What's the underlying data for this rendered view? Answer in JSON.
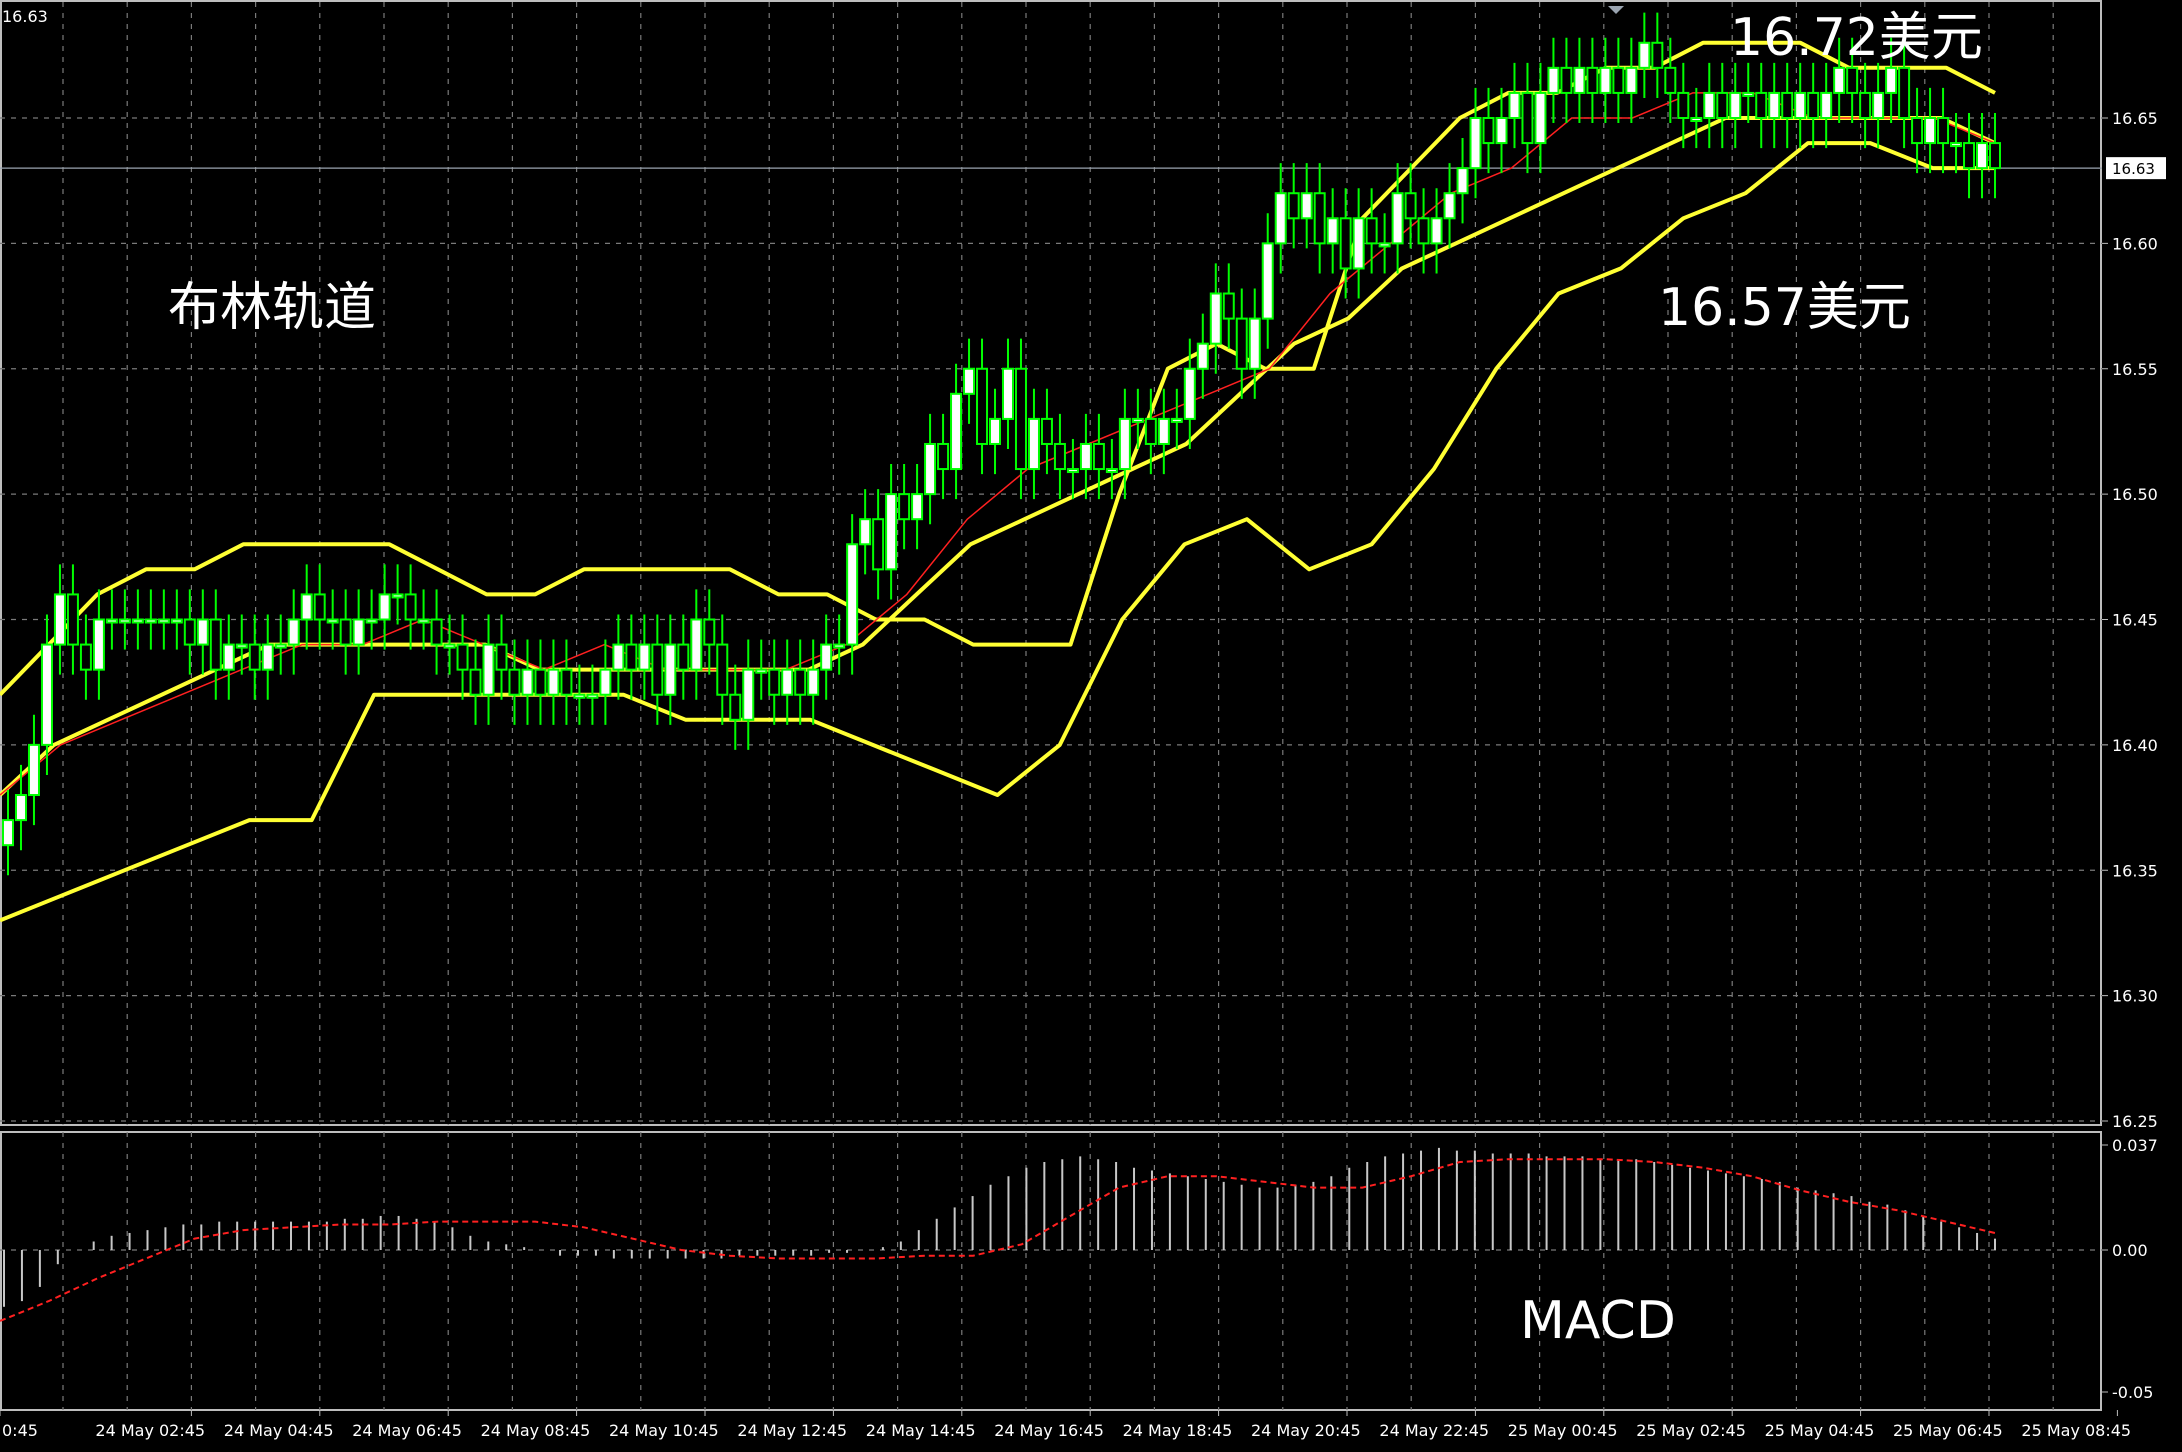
{
  "window": {
    "top_left_price": "16.63"
  },
  "colors": {
    "background": "#000000",
    "grid": "#7a7a7a",
    "bull_candle": "#00ff00",
    "bull_body": "#ffffff",
    "bear_candle": "#00ff00",
    "bear_body": "#000000",
    "bollinger": "#ffff33",
    "moving_average": "#ff2020",
    "macd_histogram": "#c8c8c8",
    "macd_signal": "#ff2020",
    "text": "#ffffff"
  },
  "annotations": {
    "bollinger_label": "布林轨道",
    "upper_price": "16.72美元",
    "lower_price": "16.57美元",
    "macd_label": "MACD"
  },
  "chart_data": [
    {
      "type": "candlestick",
      "title": "",
      "indicators": [
        "Bollinger Bands",
        "Moving Average"
      ],
      "ylim": [
        16.2,
        16.7
      ],
      "y_ticks": [
        "16.65",
        "16.60",
        "16.55",
        "16.50",
        "16.45",
        "16.40",
        "16.35",
        "16.30",
        "16.25"
      ],
      "current_price": "16.63",
      "x_ticks": [
        "0:45",
        "24 May 02:45",
        "24 May 04:45",
        "24 May 06:45",
        "24 May 08:45",
        "24 May 10:45",
        "24 May 12:45",
        "24 May 14:45",
        "24 May 16:45",
        "24 May 18:45",
        "24 May 20:45",
        "24 May 22:45",
        "25 May 00:45",
        "25 May 02:45",
        "25 May 04:45",
        "25 May 06:45",
        "25 May 08:45"
      ],
      "close": [
        16.37,
        16.38,
        16.4,
        16.44,
        16.46,
        16.44,
        16.43,
        16.45,
        16.45,
        16.45,
        16.45,
        16.45,
        16.45,
        16.45,
        16.44,
        16.45,
        16.43,
        16.44,
        16.44,
        16.43,
        16.44,
        16.44,
        16.45,
        16.46,
        16.45,
        16.45,
        16.44,
        16.45,
        16.45,
        16.46,
        16.46,
        16.45,
        16.45,
        16.44,
        16.44,
        16.43,
        16.42,
        16.44,
        16.43,
        16.42,
        16.43,
        16.42,
        16.43,
        16.42,
        16.42,
        16.42,
        16.43,
        16.44,
        16.43,
        16.44,
        16.42,
        16.44,
        16.43,
        16.45,
        16.44,
        16.42,
        16.41,
        16.43,
        16.43,
        16.42,
        16.43,
        16.42,
        16.43,
        16.44,
        16.44,
        16.48,
        16.49,
        16.47,
        16.5,
        16.49,
        16.5,
        16.52,
        16.51,
        16.54,
        16.55,
        16.52,
        16.53,
        16.55,
        16.51,
        16.53,
        16.52,
        16.51,
        16.51,
        16.52,
        16.51,
        16.51,
        16.53,
        16.53,
        16.52,
        16.53,
        16.53,
        16.55,
        16.56,
        16.58,
        16.57,
        16.55,
        16.57,
        16.6,
        16.62,
        16.61,
        16.62,
        16.6,
        16.61,
        16.59,
        16.61,
        16.6,
        16.6,
        16.62,
        16.61,
        16.6,
        16.61,
        16.62,
        16.63,
        16.65,
        16.64,
        16.65,
        16.66,
        16.64,
        16.66,
        16.67,
        16.66,
        16.67,
        16.66,
        16.67,
        16.66,
        16.67,
        16.68,
        16.67,
        16.66,
        16.65,
        16.65,
        16.66,
        16.65,
        16.66,
        16.66,
        16.65,
        16.66,
        16.65,
        16.66,
        16.65,
        16.66,
        16.67,
        16.66,
        16.65,
        16.66,
        16.67,
        16.65,
        16.64,
        16.65,
        16.64,
        16.64,
        16.63,
        16.64,
        16.63
      ],
      "bollinger_upper": [
        16.42,
        16.44,
        16.46,
        16.47,
        16.47,
        16.48,
        16.48,
        16.48,
        16.48,
        16.47,
        16.46,
        16.46,
        16.47,
        16.47,
        16.47,
        16.47,
        16.46,
        16.46,
        16.45,
        16.45,
        16.44,
        16.44,
        16.44,
        16.5,
        16.55,
        16.56,
        16.55,
        16.55,
        16.61,
        16.63,
        16.65,
        16.66,
        16.66,
        16.67,
        16.67,
        16.68,
        16.68,
        16.68,
        16.67,
        16.67,
        16.67,
        16.66
      ],
      "bollinger_middle": [
        16.38,
        16.4,
        16.41,
        16.42,
        16.43,
        16.44,
        16.44,
        16.44,
        16.44,
        16.44,
        16.43,
        16.43,
        16.43,
        16.43,
        16.43,
        16.43,
        16.44,
        16.46,
        16.48,
        16.49,
        16.5,
        16.51,
        16.52,
        16.54,
        16.56,
        16.57,
        16.59,
        16.6,
        16.61,
        16.62,
        16.63,
        16.64,
        16.65,
        16.65,
        16.65,
        16.65,
        16.65,
        16.64
      ],
      "bollinger_lower": [
        16.33,
        16.34,
        16.35,
        16.36,
        16.37,
        16.37,
        16.42,
        16.42,
        16.42,
        16.42,
        16.42,
        16.41,
        16.41,
        16.41,
        16.4,
        16.39,
        16.38,
        16.4,
        16.45,
        16.48,
        16.49,
        16.47,
        16.48,
        16.51,
        16.55,
        16.58,
        16.59,
        16.61,
        16.62,
        16.64,
        16.64,
        16.63,
        16.63
      ],
      "moving_average": [
        16.38,
        16.4,
        16.41,
        16.42,
        16.43,
        16.44,
        16.44,
        16.45,
        16.44,
        16.43,
        16.44,
        16.43,
        16.43,
        16.43,
        16.44,
        16.46,
        16.49,
        16.51,
        16.52,
        16.53,
        16.54,
        16.55,
        16.58,
        16.6,
        16.62,
        16.63,
        16.65,
        16.65,
        16.66,
        16.66,
        16.65,
        16.65,
        16.65,
        16.64
      ]
    },
    {
      "type": "bar",
      "title": "MACD",
      "ylim": [
        -0.05,
        0.037
      ],
      "y_ticks": [
        "0.037",
        "0.00",
        "-0.05"
      ],
      "histogram": [
        -0.02,
        -0.018,
        -0.013,
        -0.005,
        0.0,
        0.003,
        0.005,
        0.006,
        0.007,
        0.008,
        0.009,
        0.009,
        0.01,
        0.01,
        0.01,
        0.01,
        0.01,
        0.01,
        0.01,
        0.011,
        0.011,
        0.012,
        0.012,
        0.011,
        0.01,
        0.008,
        0.005,
        0.003,
        0.002,
        0.001,
        0.0,
        -0.002,
        -0.002,
        -0.002,
        -0.003,
        -0.003,
        -0.003,
        -0.003,
        -0.003,
        -0.003,
        -0.003,
        -0.002,
        -0.002,
        -0.002,
        -0.002,
        -0.002,
        -0.001,
        -0.001,
        0.0,
        0.001,
        0.003,
        0.007,
        0.011,
        0.015,
        0.019,
        0.023,
        0.026,
        0.029,
        0.031,
        0.032,
        0.033,
        0.032,
        0.031,
        0.029,
        0.028,
        0.027,
        0.026,
        0.025,
        0.024,
        0.023,
        0.022,
        0.022,
        0.023,
        0.024,
        0.026,
        0.029,
        0.031,
        0.033,
        0.034,
        0.035,
        0.036,
        0.035,
        0.035,
        0.034,
        0.034,
        0.034,
        0.033,
        0.033,
        0.033,
        0.032,
        0.032,
        0.032,
        0.031,
        0.03,
        0.029,
        0.028,
        0.027,
        0.026,
        0.025,
        0.024,
        0.022,
        0.021,
        0.02,
        0.019,
        0.017,
        0.016,
        0.014,
        0.012,
        0.01,
        0.008,
        0.006,
        0.004
      ],
      "signal": [
        -0.025,
        -0.018,
        -0.01,
        -0.003,
        0.004,
        0.007,
        0.008,
        0.009,
        0.009,
        0.01,
        0.01,
        0.01,
        0.008,
        0.004,
        0.0,
        -0.002,
        -0.003,
        -0.003,
        -0.003,
        -0.002,
        -0.002,
        0.002,
        0.012,
        0.022,
        0.026,
        0.026,
        0.024,
        0.022,
        0.022,
        0.026,
        0.031,
        0.032,
        0.032,
        0.032,
        0.031,
        0.029,
        0.026,
        0.021,
        0.017,
        0.014,
        0.01,
        0.006
      ]
    }
  ]
}
